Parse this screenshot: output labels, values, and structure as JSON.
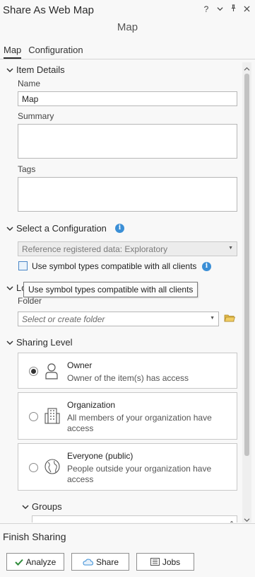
{
  "header": {
    "title": "Share As Web Map",
    "subtitle": "Map",
    "help_glyph": "?",
    "options_glyph": "⌄",
    "pin_glyph": "⊥",
    "close_glyph": "✕"
  },
  "tabs": [
    {
      "label": "Map",
      "active": true
    },
    {
      "label": "Configuration",
      "active": false
    }
  ],
  "item_details": {
    "heading": "Item Details",
    "name_label": "Name",
    "name_value": "Map",
    "summary_label": "Summary",
    "summary_value": "",
    "tags_label": "Tags",
    "tags_value": ""
  },
  "configuration": {
    "heading": "Select a Configuration",
    "selected": "Reference registered data: Exploratory",
    "checkbox_label": "Use symbol types compatible with all clients",
    "checkbox_checked": false,
    "tooltip": "Use symbol types compatible with all clients"
  },
  "location": {
    "heading_partial": "Lo",
    "folder_label": "Folder",
    "folder_placeholder": "Select or create folder"
  },
  "sharing": {
    "heading": "Sharing Level",
    "levels": [
      {
        "title": "Owner",
        "desc": "Owner of the item(s) has access",
        "selected": true,
        "icon": "person-icon"
      },
      {
        "title": "Organization",
        "desc": "All members of your organization have access",
        "selected": false,
        "icon": "building-icon"
      },
      {
        "title": "Everyone (public)",
        "desc": "People outside your organization have access",
        "selected": false,
        "icon": "globe-icon"
      }
    ],
    "groups_heading": "Groups"
  },
  "footer": {
    "heading": "Finish Sharing",
    "analyze_label": "Analyze",
    "share_label": "Share",
    "jobs_label": "Jobs"
  },
  "colors": {
    "info_blue": "#3b8fd6",
    "check_green": "#2e8b3a",
    "panel_bg": "#f8f8f8"
  }
}
